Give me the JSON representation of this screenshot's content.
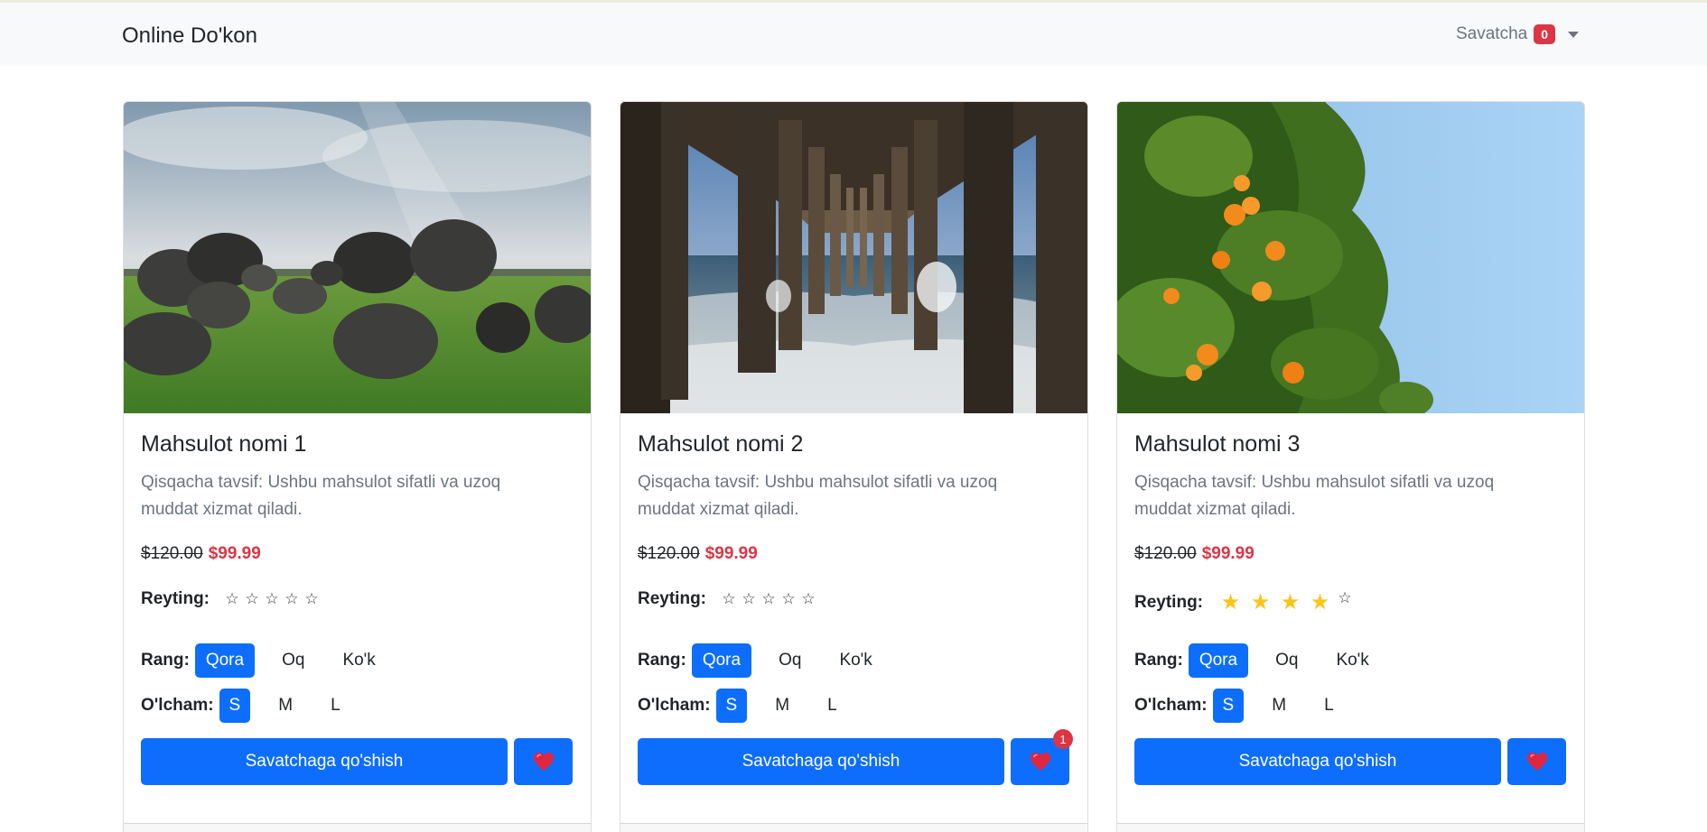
{
  "navbar": {
    "brand": "Online Do'kon",
    "cart_label": "Savatcha",
    "cart_count": "0"
  },
  "products": [
    {
      "title": "Mahsulot nomi 1",
      "description": "Qisqacha tavsif: Ushbu mahsulot sifatli va uzoq muddat xizmat qiladi.",
      "old_price": "$120.00",
      "new_price": "$99.99",
      "rating_label": "Reyting:",
      "rating": 0,
      "color_label": "Rang:",
      "colors": [
        "Qora",
        "Oq",
        "Ko'k"
      ],
      "selected_color": "Qora",
      "size_label": "O'lcham:",
      "sizes": [
        "S",
        "M",
        "L"
      ],
      "selected_size": "S",
      "add_button": "Savatchaga qo'shish",
      "favorite_icon": "heart-icon",
      "favorite_count": ""
    },
    {
      "title": "Mahsulot nomi 2",
      "description": "Qisqacha tavsif: Ushbu mahsulot sifatli va uzoq muddat xizmat qiladi.",
      "old_price": "$120.00",
      "new_price": "$99.99",
      "rating_label": "Reyting:",
      "rating": 0,
      "color_label": "Rang:",
      "colors": [
        "Qora",
        "Oq",
        "Ko'k"
      ],
      "selected_color": "Qora",
      "size_label": "O'lcham:",
      "sizes": [
        "S",
        "M",
        "L"
      ],
      "selected_size": "S",
      "add_button": "Savatchaga qo'shish",
      "favorite_icon": "heart-icon",
      "favorite_count": "1"
    },
    {
      "title": "Mahsulot nomi 3",
      "description": "Qisqacha tavsif: Ushbu mahsulot sifatli va uzoq muddat xizmat qiladi.",
      "old_price": "$120.00",
      "new_price": "$99.99",
      "rating_label": "Reyting:",
      "rating": 4,
      "color_label": "Rang:",
      "colors": [
        "Qora",
        "Oq",
        "Ko'k"
      ],
      "selected_color": "Qora",
      "size_label": "O'lcham:",
      "sizes": [
        "S",
        "M",
        "L"
      ],
      "selected_size": "S",
      "add_button": "Savatchaga qo'shish",
      "favorite_icon": "heart-icon",
      "favorite_count": ""
    }
  ],
  "colors": {
    "primary": "#0d6efd",
    "danger": "#dc3545",
    "star": "#fcc419",
    "navbar_bg": "#f8f9fa"
  }
}
